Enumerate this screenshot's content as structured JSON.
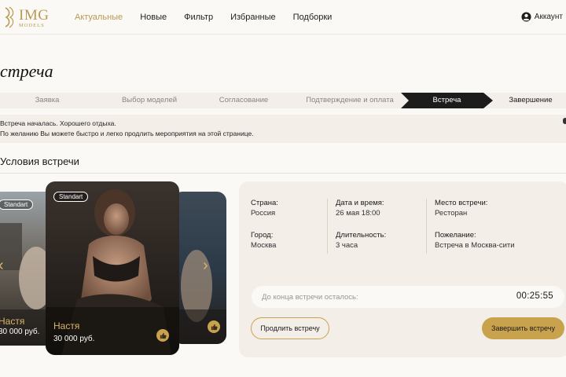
{
  "header": {
    "logo": {
      "text": "IMG",
      "sub": "MODELS"
    },
    "nav": [
      {
        "label": "Актуальные",
        "active": true
      },
      {
        "label": "Новые",
        "active": false
      },
      {
        "label": "Фильтр",
        "active": false
      },
      {
        "label": "Избранные",
        "active": false
      },
      {
        "label": "Подборки",
        "active": false
      }
    ],
    "account_label": "Аккаунт",
    "account_icon": "user-circle-icon"
  },
  "page_title": "стреча",
  "steps": [
    {
      "label": "Заявка",
      "state": "done"
    },
    {
      "label": "Выбор моделей",
      "state": "done"
    },
    {
      "label": "Согласование",
      "state": "done"
    },
    {
      "label": "Подтверждение и оплата",
      "state": "done"
    },
    {
      "label": "Встреча",
      "state": "current"
    },
    {
      "label": "Завершение",
      "state": "upcoming"
    }
  ],
  "notice": {
    "line1": "Встреча началась. Хорошего отдыха.",
    "line2": "По желанию Вы можете быстро и легко продлить мероприятия на этой странице."
  },
  "section_title": "Условия встречи",
  "cards": {
    "back_left": {
      "badge": "Standart",
      "name": "Настя",
      "price": "30 000 руб."
    },
    "front": {
      "badge": "Standart",
      "name": "Настя",
      "price": "30 000 руб."
    },
    "nav_icons": [
      "chevron-left-icon",
      "chevron-right-icon"
    ]
  },
  "details": {
    "country": {
      "label": "Страна:",
      "value": "Россия"
    },
    "datetime": {
      "label": "Дата и время:",
      "value": "26 мая 18:00"
    },
    "place": {
      "label": "Место встречи:",
      "value": "Ресторан"
    },
    "city": {
      "label": "Город:",
      "value": "Москва"
    },
    "duration": {
      "label": "Длительность:",
      "value": "3 часа"
    },
    "wish": {
      "label": "Пожелание:",
      "value": "Встреча в Москва-сити"
    }
  },
  "timer": {
    "label": "До конца встречи осталось:",
    "value": "00:25:55"
  },
  "buttons": {
    "extend": "Продлить встречу",
    "finish": "Завершить встречу"
  },
  "colors": {
    "accent": "#c9a24e",
    "background": "#fbf9f5",
    "panel": "#f4eee9",
    "dark": "#1a1a1a"
  }
}
